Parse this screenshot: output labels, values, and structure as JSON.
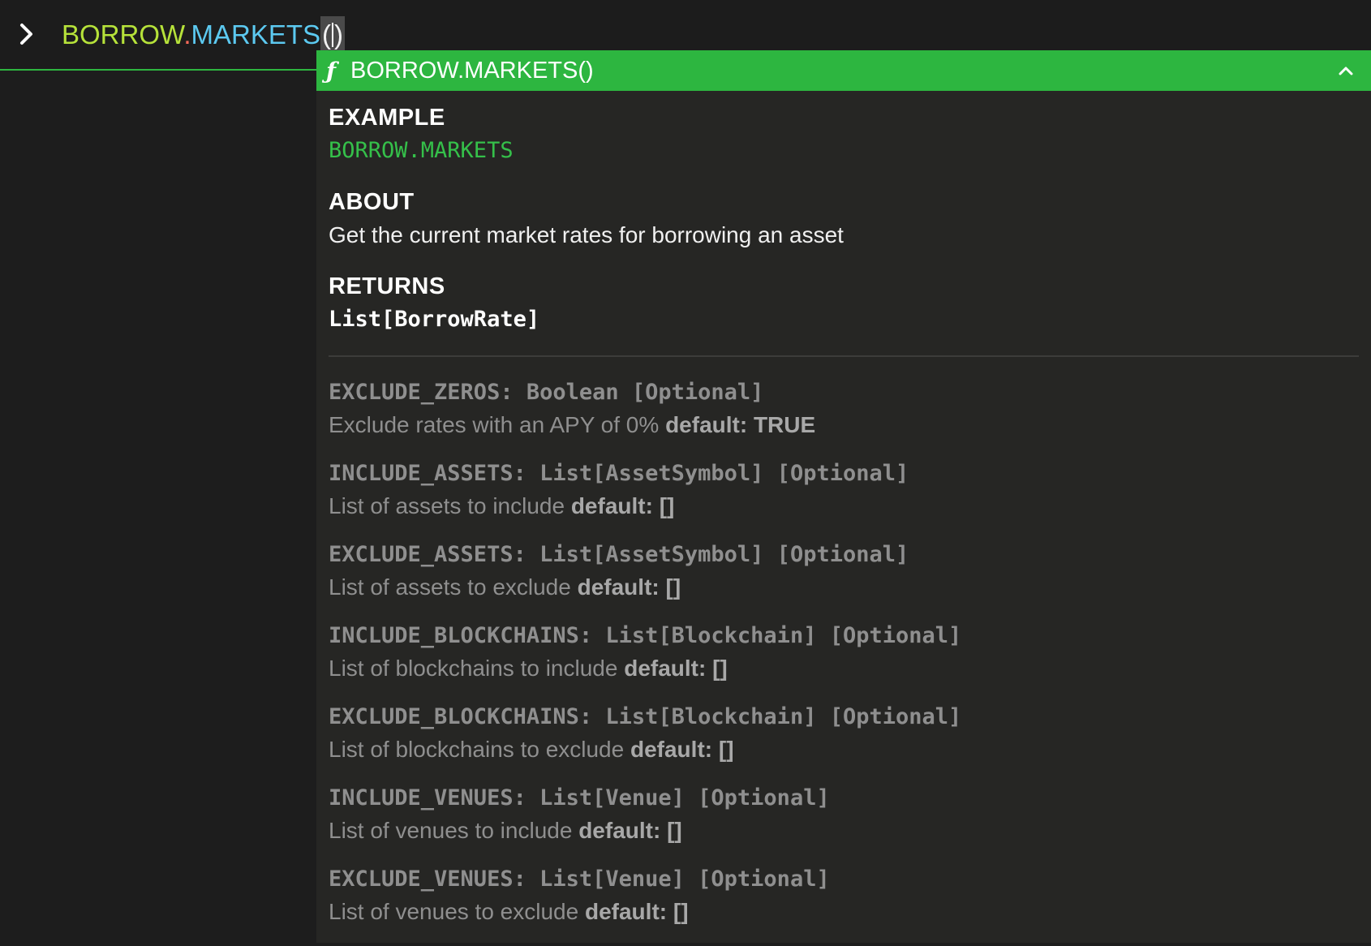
{
  "command": {
    "function_name": "BORROW",
    "dot": ".",
    "member": "MARKETS",
    "open_paren": "(",
    "close_paren": ")"
  },
  "doc": {
    "title": "BORROW.MARKETS()",
    "example": {
      "heading": "EXAMPLE",
      "code": "BORROW.MARKETS"
    },
    "about": {
      "heading": "ABOUT",
      "text": "Get the current market rates for borrowing an asset"
    },
    "returns": {
      "heading": "RETURNS",
      "type": "List[BorrowRate]"
    },
    "params": [
      {
        "signature": "EXCLUDE_ZEROS: Boolean [Optional]",
        "description": "Exclude rates with an APY of 0% ",
        "default": "default: TRUE"
      },
      {
        "signature": "INCLUDE_ASSETS: List[AssetSymbol] [Optional]",
        "description": "List of assets to include ",
        "default": "default: []"
      },
      {
        "signature": "EXCLUDE_ASSETS: List[AssetSymbol] [Optional]",
        "description": "List of assets to exclude ",
        "default": "default: []"
      },
      {
        "signature": "INCLUDE_BLOCKCHAINS: List[Blockchain] [Optional]",
        "description": "List of blockchains to include ",
        "default": "default: []"
      },
      {
        "signature": "EXCLUDE_BLOCKCHAINS: List[Blockchain] [Optional]",
        "description": "List of blockchains to exclude ",
        "default": "default: []"
      },
      {
        "signature": "INCLUDE_VENUES: List[Venue] [Optional]",
        "description": "List of venues to include ",
        "default": "default: []"
      },
      {
        "signature": "EXCLUDE_VENUES: List[Venue] [Optional]",
        "description": "List of venues to exclude ",
        "default": "default: []"
      }
    ]
  },
  "icons": {
    "prompt": "chevron-right-icon",
    "function": "function-icon",
    "collapse": "chevron-up-icon"
  },
  "colors": {
    "accent_green": "#2db640",
    "function_token": "#b6e23a",
    "member_token": "#5cc9f0",
    "dot_token": "#ff6b5b",
    "panel_bg": "#262624",
    "page_bg": "#1d1d1d"
  }
}
